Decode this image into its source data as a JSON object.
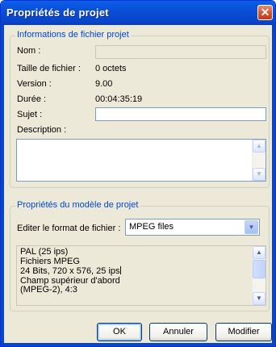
{
  "window": {
    "title": "Propriétés de projet",
    "close_glyph": "✕"
  },
  "file_info": {
    "legend": "Informations de fichier projet",
    "name_label": "Nom :",
    "name_value": "",
    "size_label": "Taille de fichier :",
    "size_value": "0 octets",
    "version_label": "Version :",
    "version_value": "9.00",
    "duration_label": "Durée :",
    "duration_value": "00:04:35:19",
    "subject_label": "Sujet :",
    "subject_value": "",
    "description_label": "Description :",
    "description_value": ""
  },
  "template": {
    "legend": "Propriétés du modèle de projet",
    "format_label": "Editer le format de fichier :",
    "format_selected": "MPEG files",
    "details_lines": [
      "PAL (25 ips)",
      "Fichiers MPEG",
      "24 Bits, 720 x 576, 25 ips",
      "Champ supérieur d'abord",
      "(MPEG-2),  4:3"
    ]
  },
  "buttons": {
    "ok": "OK",
    "cancel": "Annuler",
    "modify": "Modifier"
  },
  "icons": {
    "up": "▲",
    "down": "▼"
  },
  "colors": {
    "title_bar": "#0a4fd7",
    "group_legend": "#0046d5",
    "close_button": "#d0542f",
    "dialog_bg": "#ece9d8"
  }
}
